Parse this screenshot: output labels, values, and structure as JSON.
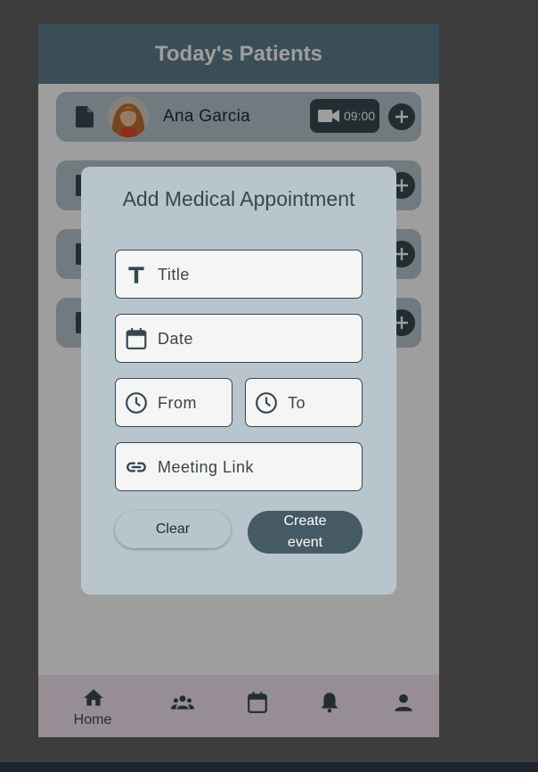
{
  "app": {
    "title": "Today's Patients",
    "accent_color": "#607d8b",
    "button_color": "#455a64"
  },
  "patients": [
    {
      "name": "Ana Garcia",
      "time": "09:00",
      "icon": "description-icon",
      "call_icon": "videocam-icon",
      "action_icon": "add-circle-icon"
    }
  ],
  "dialog": {
    "title": "Add Medical Appointment",
    "fields": {
      "title": {
        "placeholder": "Title",
        "icon": "text-fields-icon"
      },
      "date": {
        "placeholder": "Date",
        "icon": "calendar-icon"
      },
      "from": {
        "placeholder": "From",
        "icon": "clock-icon"
      },
      "to": {
        "placeholder": "To",
        "icon": "clock-icon"
      },
      "meeting_link": {
        "placeholder": "Meeting Link",
        "icon": "link-icon"
      }
    },
    "clear_label": "Clear",
    "create_label": "Create event"
  },
  "bottom_nav": {
    "selected": "home",
    "items": [
      {
        "id": "home",
        "label": "Home",
        "icon": "home-icon"
      },
      {
        "id": "patients",
        "label": "",
        "icon": "people-icon"
      },
      {
        "id": "calendar",
        "label": "",
        "icon": "calendar-icon"
      },
      {
        "id": "notifications",
        "label": "",
        "icon": "bell-icon"
      },
      {
        "id": "profile",
        "label": "",
        "icon": "person-icon"
      }
    ]
  }
}
